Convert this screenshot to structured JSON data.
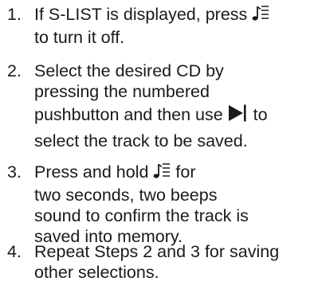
{
  "steps": [
    {
      "number": "1.",
      "parts": [
        "If S-LIST is displayed, press",
        "to turn it off."
      ]
    },
    {
      "number": "2.",
      "lines": [
        "Select the desired CD by",
        "pressing the numbered"
      ],
      "parts": [
        "pushbutton and then use",
        "to",
        "select the track to be saved."
      ]
    },
    {
      "number": "3.",
      "parts": [
        "Press and hold",
        "for",
        "two seconds, two beeps",
        "sound to confirm the track is",
        "saved into memory."
      ]
    },
    {
      "number": "4.",
      "lines": [
        "Repeat Steps 2 and 3 for saving",
        "other selections."
      ]
    }
  ],
  "icons": {
    "slist": "music-note-list-icon",
    "next": "next-track-icon"
  }
}
